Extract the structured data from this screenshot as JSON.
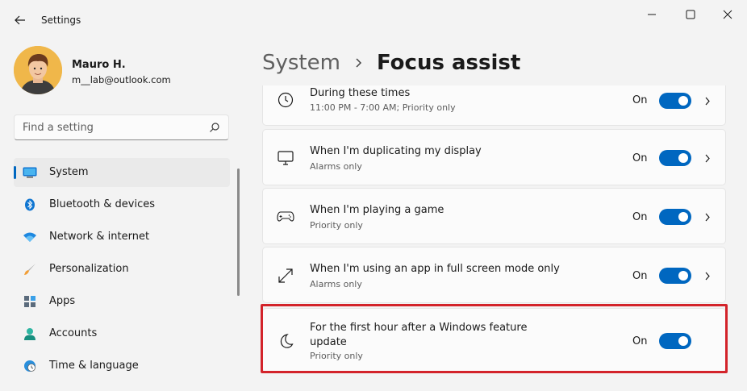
{
  "window": {
    "title": "Settings"
  },
  "profile": {
    "name": "Mauro H.",
    "email": "m__lab@outlook.com"
  },
  "search": {
    "placeholder": "Find a setting"
  },
  "nav": {
    "items": [
      {
        "label": "System",
        "icon": "system-display-icon",
        "active": true
      },
      {
        "label": "Bluetooth & devices",
        "icon": "bluetooth-icon"
      },
      {
        "label": "Network & internet",
        "icon": "wifi-icon"
      },
      {
        "label": "Personalization",
        "icon": "brush-icon"
      },
      {
        "label": "Apps",
        "icon": "apps-icon"
      },
      {
        "label": "Accounts",
        "icon": "person-icon"
      },
      {
        "label": "Time & language",
        "icon": "globe-clock-icon"
      }
    ]
  },
  "breadcrumb": {
    "parent": "System",
    "current": "Focus assist"
  },
  "rules": [
    {
      "title": "During these times",
      "subtitle": "11:00 PM - 7:00 AM; Priority only",
      "state": "On",
      "icon": "clock-icon"
    },
    {
      "title": "When I'm duplicating my display",
      "subtitle": "Alarms only",
      "state": "On",
      "icon": "monitor-icon"
    },
    {
      "title": "When I'm playing a game",
      "subtitle": "Priority only",
      "state": "On",
      "icon": "gamepad-icon"
    },
    {
      "title": "When I'm using an app in full screen mode only",
      "subtitle": "Alarms only",
      "state": "On",
      "icon": "fullscreen-icon"
    },
    {
      "title_line1": "For the first hour after a Windows feature",
      "title_line2": "update",
      "subtitle": "Priority only",
      "state": "On",
      "icon": "moon-icon"
    }
  ],
  "colors": {
    "accent": "#0067c0",
    "highlight": "#d3232a"
  }
}
